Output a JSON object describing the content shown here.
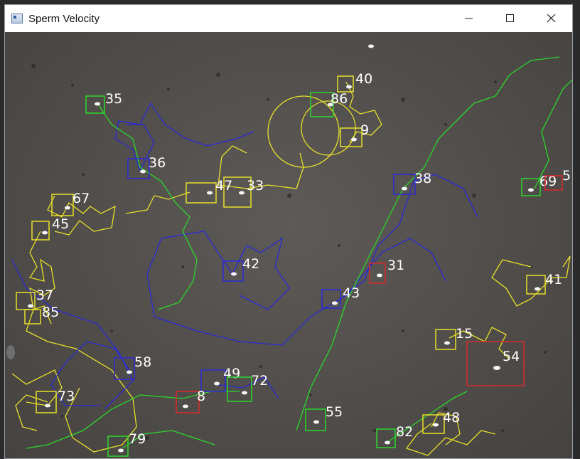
{
  "window": {
    "title": "Sperm Velocity",
    "minimize_icon": "minimize-icon",
    "maximize_icon": "maximize-icon",
    "close_icon": "close-icon"
  },
  "colors": {
    "blue_box": "#2b2bd8",
    "green_box": "#2bd82b",
    "yellow_box": "#e8e02a",
    "red_box": "#d82b2b"
  },
  "tracks": [
    {
      "id": "35",
      "box": "green"
    },
    {
      "id": "86",
      "box": "green"
    },
    {
      "id": "40",
      "box": "yellow"
    },
    {
      "id": "9",
      "box": "yellow"
    },
    {
      "id": "36",
      "box": "blue"
    },
    {
      "id": "47",
      "box": "yellow"
    },
    {
      "id": "33",
      "box": "yellow"
    },
    {
      "id": "38",
      "box": "blue"
    },
    {
      "id": "69",
      "box": "green"
    },
    {
      "id": "5",
      "box": "red"
    },
    {
      "id": "67",
      "box": "yellow"
    },
    {
      "id": "45",
      "box": "yellow"
    },
    {
      "id": "42",
      "box": "blue"
    },
    {
      "id": "31",
      "box": "red"
    },
    {
      "id": "41",
      "box": "yellow"
    },
    {
      "id": "37",
      "box": "yellow"
    },
    {
      "id": "85",
      "box": "yellow"
    },
    {
      "id": "43",
      "box": "blue"
    },
    {
      "id": "15",
      "box": "yellow"
    },
    {
      "id": "54",
      "box": "red"
    },
    {
      "id": "58",
      "box": "blue"
    },
    {
      "id": "49",
      "box": "blue"
    },
    {
      "id": "72",
      "box": "green"
    },
    {
      "id": "8",
      "box": "red"
    },
    {
      "id": "73",
      "box": "yellow"
    },
    {
      "id": "55",
      "box": "green"
    },
    {
      "id": "48",
      "box": "yellow"
    },
    {
      "id": "82",
      "box": "green"
    },
    {
      "id": "79",
      "box": "green"
    }
  ]
}
